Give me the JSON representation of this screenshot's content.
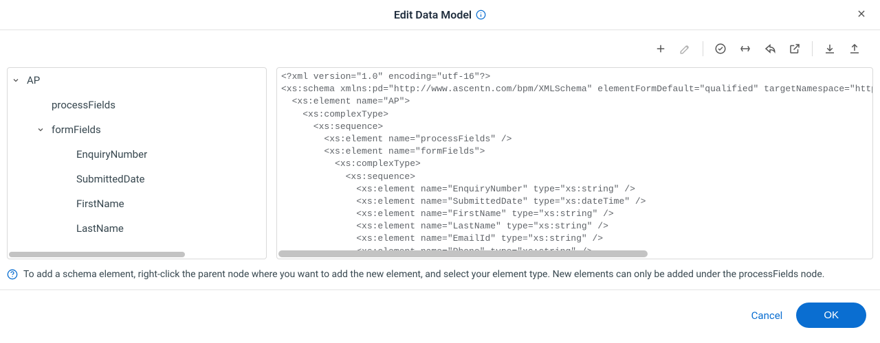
{
  "header": {
    "title": "Edit Data Model"
  },
  "tree": {
    "nodes": [
      {
        "label": "AP",
        "level": 0,
        "expanded": true,
        "hasChildren": true
      },
      {
        "label": "processFields",
        "level": 1,
        "expanded": false,
        "hasChildren": false
      },
      {
        "label": "formFields",
        "level": 1,
        "expanded": true,
        "hasChildren": true
      },
      {
        "label": "EnquiryNumber",
        "level": 2,
        "expanded": false,
        "hasChildren": false
      },
      {
        "label": "SubmittedDate",
        "level": 2,
        "expanded": false,
        "hasChildren": false
      },
      {
        "label": "FirstName",
        "level": 2,
        "expanded": false,
        "hasChildren": false
      },
      {
        "label": "LastName",
        "level": 2,
        "expanded": false,
        "hasChildren": false
      }
    ]
  },
  "code": {
    "text": "<?xml version=\"1.0\" encoding=\"utf-16\"?>\n<xs:schema xmlns:pd=\"http://www.ascentn.com/bpm/XMLSchema\" elementFormDefault=\"qualified\" targetNamespace=\"http://www\n  <xs:element name=\"AP\">\n    <xs:complexType>\n      <xs:sequence>\n        <xs:element name=\"processFields\" />\n        <xs:element name=\"formFields\">\n          <xs:complexType>\n            <xs:sequence>\n              <xs:element name=\"EnquiryNumber\" type=\"xs:string\" />\n              <xs:element name=\"SubmittedDate\" type=\"xs:dateTime\" />\n              <xs:element name=\"FirstName\" type=\"xs:string\" />\n              <xs:element name=\"LastName\" type=\"xs:string\" />\n              <xs:element name=\"EmailId\" type=\"xs:string\" />\n              <xs:element name=\"Phone\" type=\"xs:string\" />\n              <xs:element name=\"CompanyName\" type=\"xs:string\" />\n              <xs:element name=\"Addresss\" type=\"xs:string\" />"
  },
  "help": {
    "text": "To add a schema element, right-click the parent node where you want to add the new element, and select your element type. New elements can only be added under the processFields node."
  },
  "footer": {
    "cancel": "Cancel",
    "ok": "OK"
  }
}
